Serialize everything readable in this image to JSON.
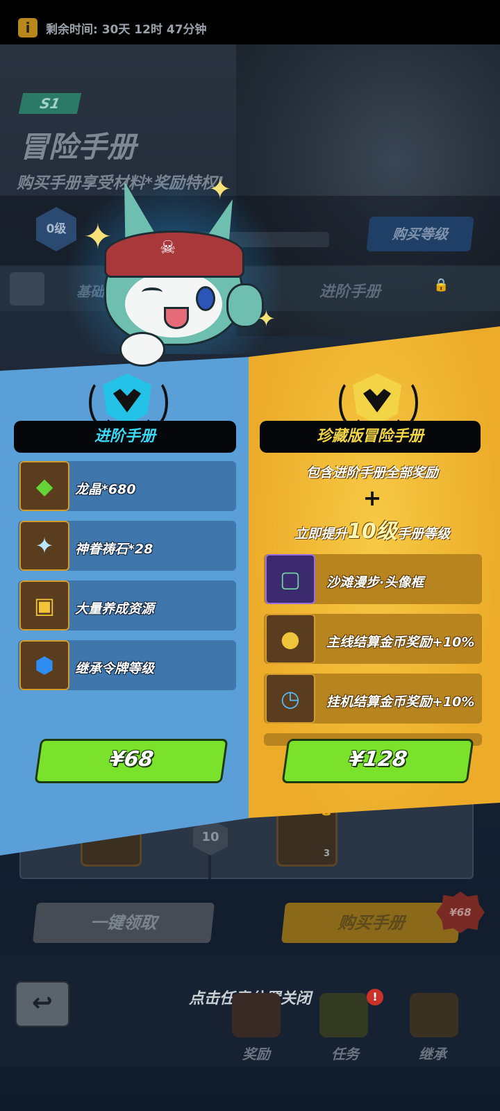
{
  "background": {
    "remaining_time": "剩余时间: 30天 12时 47分钟",
    "season_badge": "S1",
    "title": "冒险手册",
    "subtitle": "购买手册享受材料*奖励特权!",
    "level_badge": "0级",
    "buy_level_button": "购买等级",
    "tab_left": "基础",
    "tab_right": "进阶手册",
    "reward_level": "10",
    "reward_slot_count": "3",
    "claim_all_button": "一键领取",
    "buy_book_button": "购买手册",
    "price_tag": "¥68",
    "close_hint": "点击任意位置关闭",
    "nav": [
      {
        "label": "奖励",
        "icon": "shop-icon"
      },
      {
        "label": "任务",
        "icon": "task-box-icon"
      },
      {
        "label": "继承",
        "icon": "treasure-chest-icon"
      }
    ],
    "task_alert": "!"
  },
  "advanced": {
    "title": "进阶手册",
    "rewards": [
      {
        "label": "龙晶*680",
        "icon": "green-crystal-icon"
      },
      {
        "label": "神眷祷石*28",
        "icon": "blessing-stone-icon"
      },
      {
        "label": "大量养成资源",
        "icon": "treasure-chest-icon"
      },
      {
        "label": "继承令牌等级",
        "icon": "blue-hexagon-token-icon"
      }
    ],
    "price": "¥68"
  },
  "premium": {
    "title": "珍藏版冒险手册",
    "includes": "包含进阶手册全部奖励",
    "plus": "+",
    "instant_prefix": "立即提升",
    "instant_level": "10级",
    "instant_suffix": "手册等级",
    "rewards": [
      {
        "label": "沙滩漫步·头像框",
        "icon": "beach-avatar-frame-icon"
      },
      {
        "label": "主线结算金币奖励+10%",
        "icon": "gold-coin-bag-icon"
      },
      {
        "label": "挂机结算金币奖励+10%",
        "icon": "clock-coins-icon"
      }
    ],
    "price": "¥128"
  },
  "colors": {
    "left_panel": "#5b9fd8",
    "right_panel": "#ecac2a",
    "buy_button": "#7be22b",
    "left_title": "#39d9f5",
    "right_title": "#f2d544"
  }
}
